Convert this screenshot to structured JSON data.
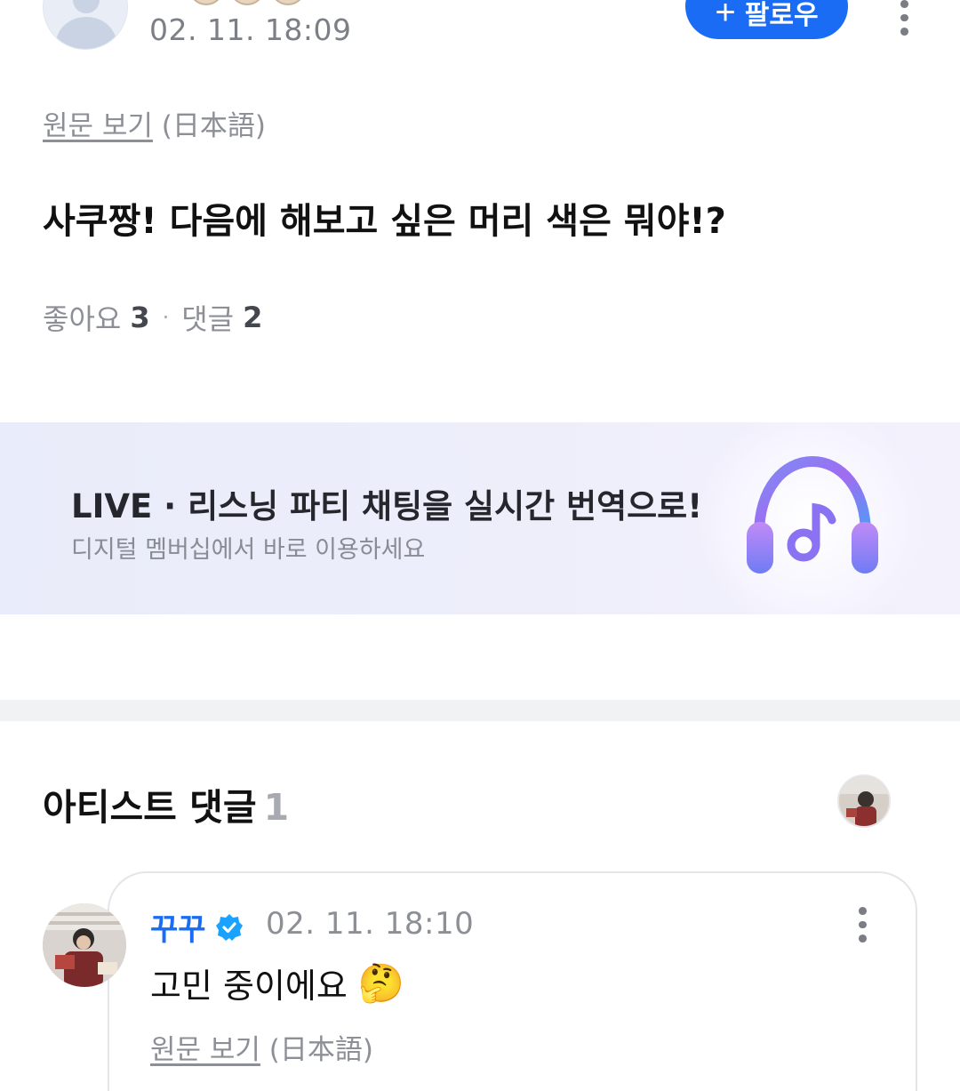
{
  "post": {
    "date": "02. 11. 18:09",
    "follow_label": "팔로우",
    "follow_icon": "plus-icon",
    "original_link": "원문 보기",
    "original_lang": "(日本語)",
    "text": "사쿠짱! 다음에 해보고 싶은 머리 색은 뭐야!?",
    "likes_label": "좋아요",
    "likes_count": "3",
    "separator": "·",
    "comments_label": "댓글",
    "comments_count": "2"
  },
  "banner": {
    "title": "LIVE · 리스닝 파티 채팅을 실시간 번역으로!",
    "subtitle": "디지털 멤버십에서 바로 이용하세요",
    "icon": "headphone-music-icon"
  },
  "artist_comments": {
    "title": "아티스트 댓글",
    "count": "1",
    "comment": {
      "author": "꾸꾸",
      "date": "02. 11. 18:10",
      "text": "고민 중이에요",
      "emoji": "🤔",
      "original_link": "원문 보기",
      "original_lang": "(日本語)"
    }
  },
  "colors": {
    "accent": "#1a6cf4",
    "muted_text": "#8c8f96",
    "verify_badge": "#19a2ff"
  }
}
